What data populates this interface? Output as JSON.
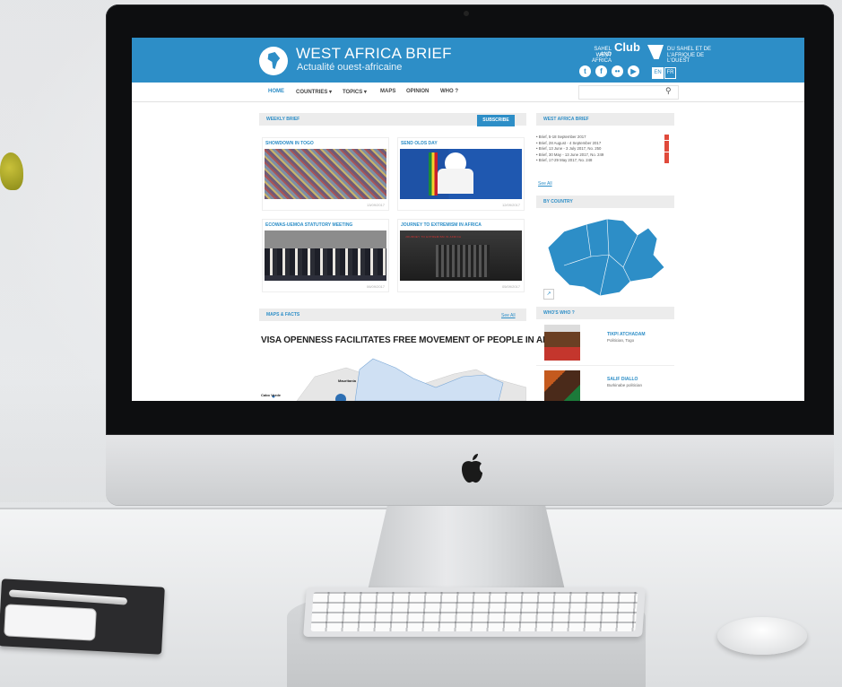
{
  "site": {
    "title": "WEST AFRICA BRIEF",
    "subtitle": "Actualité ouest-africaine",
    "club_line1": "SAHEL AND",
    "club_line2": "WEST AFRICA",
    "club_word": "Club",
    "club_right1": "DU SAHEL ET DE",
    "club_right2": "L'AFRIQUE DE L'OUEST",
    "languages": [
      "EN",
      "FR"
    ],
    "active_language": "EN"
  },
  "nav": {
    "items": [
      "HOME",
      "COUNTRIES ▾",
      "TOPICS ▾",
      "MAPS",
      "OPINION",
      "WHO ?"
    ],
    "active": "HOME"
  },
  "weekly": {
    "heading": "WEEKLY BRIEF",
    "subscribe": "SUBSCRIBE",
    "cards": [
      {
        "title": "SHOWDOWN IN TOGO",
        "date": "13/09/2017"
      },
      {
        "title": "SEND OLDS DAY",
        "date": "12/09/2017"
      },
      {
        "title": "ECOWAS-UEMOA STATUTORY MEETING",
        "date": "06/09/2017"
      },
      {
        "title": "JOURNEY TO EXTREMISM IN AFRICA",
        "date": "05/09/2017",
        "caption": "JOURNEY TO EXTREMISM IN AFRICA"
      }
    ]
  },
  "maps_facts": {
    "heading": "MAPS & FACTS",
    "see_all": "See All",
    "headline": "VISA OPENNESS FACILITATES FREE MOVEMENT OF PEOPLE IN AFRICA",
    "labels": [
      "Mauritania",
      "Cabo Verde"
    ]
  },
  "sidebar": {
    "wab_heading": "WEST AFRICA BRIEF",
    "briefs": [
      "Brief, 5-18 September 2017",
      "Brief, 28 August - 4 September 2017",
      "Brief, 13 June - 3 July 2017, No. 250",
      "Brief, 30 May - 13 June 2017, No. 249",
      "Brief, 17-29 May 2017, No. 248"
    ],
    "see_all": "See All",
    "country_heading": "BY COUNTRY",
    "who_heading": "WHO'S WHO ?",
    "people": [
      {
        "name": "TIKPI ATCHADAM",
        "desc": "Politician, Togo"
      },
      {
        "name": "SALIF DIALLO",
        "desc": "Burkinabe politician"
      }
    ]
  },
  "colors": {
    "brand_blue": "#2d8ec7",
    "pdf_red": "#e04a3b"
  },
  "icons": {
    "social": [
      "twitter-icon",
      "facebook-icon",
      "flickr-icon",
      "youtube-icon"
    ],
    "search": "search-icon",
    "expand": "expand-icon",
    "apple": "apple-logo-icon"
  }
}
